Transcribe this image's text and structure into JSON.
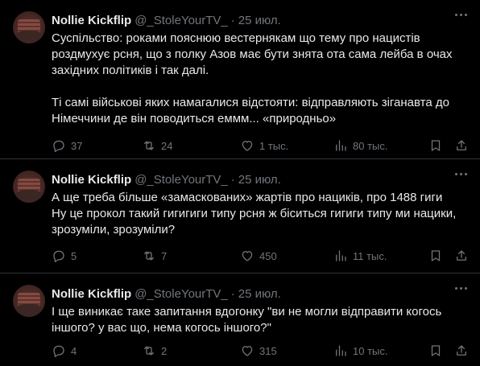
{
  "tweets": [
    {
      "author_name": "Nollie Kickflip",
      "author_handle": "@_StoleYourTV_",
      "separator": "·",
      "time": "25 июл.",
      "text_lines": [
        "Суспільство: роками пояснюю вестернякам що тему про нацистів",
        "роздмухує рсня, що з полку Азов має бути знята ота сама лейба в очах",
        "західних політиків і так далі.",
        "",
        "Ті самі військові яких намагалися відстояти: відправляють зіганавта до",
        "Німеччини де він поводиться еммм... «природньо»"
      ],
      "replies": "37",
      "retweets": "24",
      "likes": "1 тыс.",
      "views": "80 тыс."
    },
    {
      "author_name": "Nollie Kickflip",
      "author_handle": "@_StoleYourTV_",
      "separator": "·",
      "time": "25 июл.",
      "text_lines": [
        "А ще треба більше «замаскованих» жартів про нациків, про 1488 гиги",
        "Ну це прокол такий гигигиги типу рсня ж біситься гигиги типу ми нацики,",
        "зрозуміли, зрозуміли?"
      ],
      "replies": "5",
      "retweets": "7",
      "likes": "450",
      "views": "11 тыс."
    },
    {
      "author_name": "Nollie Kickflip",
      "author_handle": "@_StoleYourTV_",
      "separator": "·",
      "time": "25 июл.",
      "text_lines": [
        "І ще виникає таке запитання вдогонку \"ви не могли відправити когось",
        "іншого? у вас що, нема когось іншого?\""
      ],
      "replies": "4",
      "retweets": "2",
      "likes": "315",
      "views": "10 тыс."
    }
  ],
  "colors": {
    "background": "#000000",
    "text": "#e7e9ea",
    "muted": "#71767b",
    "divider": "#2f3336"
  },
  "icons": [
    "more-icon",
    "reply-icon",
    "retweet-icon",
    "like-icon",
    "views-icon",
    "bookmark-icon",
    "share-icon"
  ]
}
